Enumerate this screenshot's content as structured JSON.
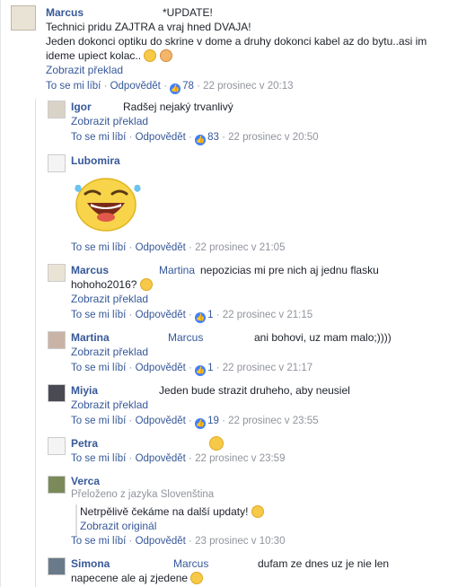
{
  "main": {
    "author": "Marcus",
    "text_l1": "*UPDATE!",
    "text_l2": "Technici pridu ZAJTRA a vraj hned DVAJA!",
    "text_l3": "Jeden dokonci optiku do skrine v dome a druhy dokonci kabel az do bytu..asi im",
    "text_l4": "ideme upiect kolac..",
    "translate": "Zobrazit překlad",
    "like": "To se mi líbí",
    "reply": "Odpovědět",
    "likes": "78",
    "time": "22 prosinec v 20:13"
  },
  "comments": [
    {
      "author": "Igor",
      "text": "Radšej nejaký trvanlivý",
      "translate": "Zobrazit překlad",
      "like": "To se mi líbí",
      "reply": "Odpovědět",
      "likes": "83",
      "time": "22 prosinec v 20:50"
    },
    {
      "author": "Lubomira",
      "like": "To se mi líbí",
      "reply": "Odpovědět",
      "time": "22 prosinec v 21:05"
    },
    {
      "author": "Marcus",
      "mention": "Martina",
      "text": "nepozicias mi pre nich aj jednu flasku",
      "text2": "hohoho2016?",
      "translate": "Zobrazit překlad",
      "like": "To se mi líbí",
      "reply": "Odpovědět",
      "likes": "1",
      "time": "22 prosinec v 21:15"
    },
    {
      "author": "Martina",
      "mention": "Marcus",
      "text": "ani bohovi, uz mam malo;))))",
      "translate": "Zobrazit překlad",
      "like": "To se mi líbí",
      "reply": "Odpovědět",
      "likes": "1",
      "time": "22 prosinec v 21:17"
    },
    {
      "author": "Miyia",
      "text": "Jeden bude strazit druheho, aby neusiel",
      "translate": "Zobrazit překlad",
      "like": "To se mi líbí",
      "reply": "Odpovědět",
      "likes": "19",
      "time": "22 prosinec v 23:55"
    },
    {
      "author": "Petra",
      "like": "To se mi líbí",
      "reply": "Odpovědět",
      "time": "22 prosinec v 23:59"
    },
    {
      "author": "Verca",
      "translated_from": "Přeloženo z jazyka Slovenština",
      "text": "Netrpělivě čekáme na další updaty!",
      "original": "Zobrazit originál",
      "like": "To se mi líbí",
      "reply": "Odpovědět",
      "time": "23 prosinec v 10:30"
    },
    {
      "author": "Simona",
      "mention": "Marcus",
      "text": "dufam ze dnes uz je nie len",
      "text2": "napecene ale aj zjedene"
    }
  ],
  "colors": {
    "link": "#365899",
    "meta": "#90949c",
    "like_badge": "#4080ff",
    "emoji": "#f7c948"
  }
}
